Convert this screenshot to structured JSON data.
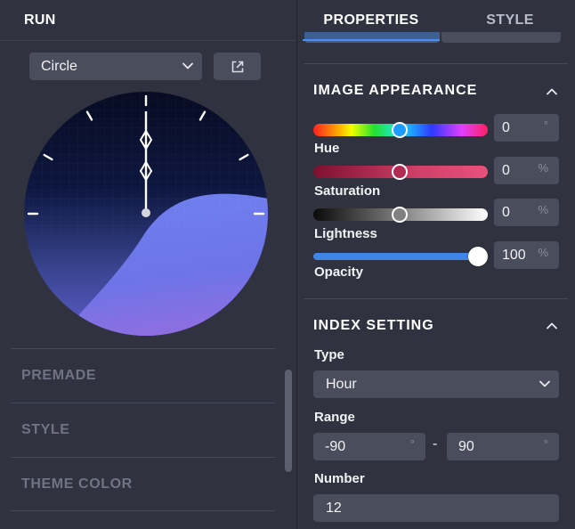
{
  "left": {
    "title": "RUN",
    "shape_select": {
      "value": "Circle"
    },
    "accordions": [
      "PREMADE",
      "STYLE",
      "THEME COLOR"
    ]
  },
  "tabs": [
    "PROPERTIES",
    "STYLE"
  ],
  "image_appearance": {
    "title": "IMAGE APPEARANCE",
    "hue": {
      "label": "Hue",
      "value": "0",
      "unit": "°",
      "level": 0.5
    },
    "saturation": {
      "label": "Saturation",
      "value": "0",
      "unit": "%",
      "level": 0.5
    },
    "lightness": {
      "label": "Lightness",
      "value": "0",
      "unit": "%",
      "level": 0.5
    },
    "opacity": {
      "label": "Opacity",
      "value": "100",
      "unit": "%",
      "level": 1.0
    }
  },
  "index_setting": {
    "title": "INDEX SETTING",
    "type_label": "Type",
    "type_value": "Hour",
    "range_label": "Range",
    "range_min": "-90",
    "range_max": "90",
    "range_unit": "°",
    "range_separator": "-",
    "number_label": "Number",
    "number_value": "12"
  },
  "colors": {
    "accent": "#4a90f0",
    "panel": "#30333f",
    "field": "#4a4d5c",
    "dial_top": "#0b1230",
    "dial_bottom": "#7a5ce0"
  }
}
